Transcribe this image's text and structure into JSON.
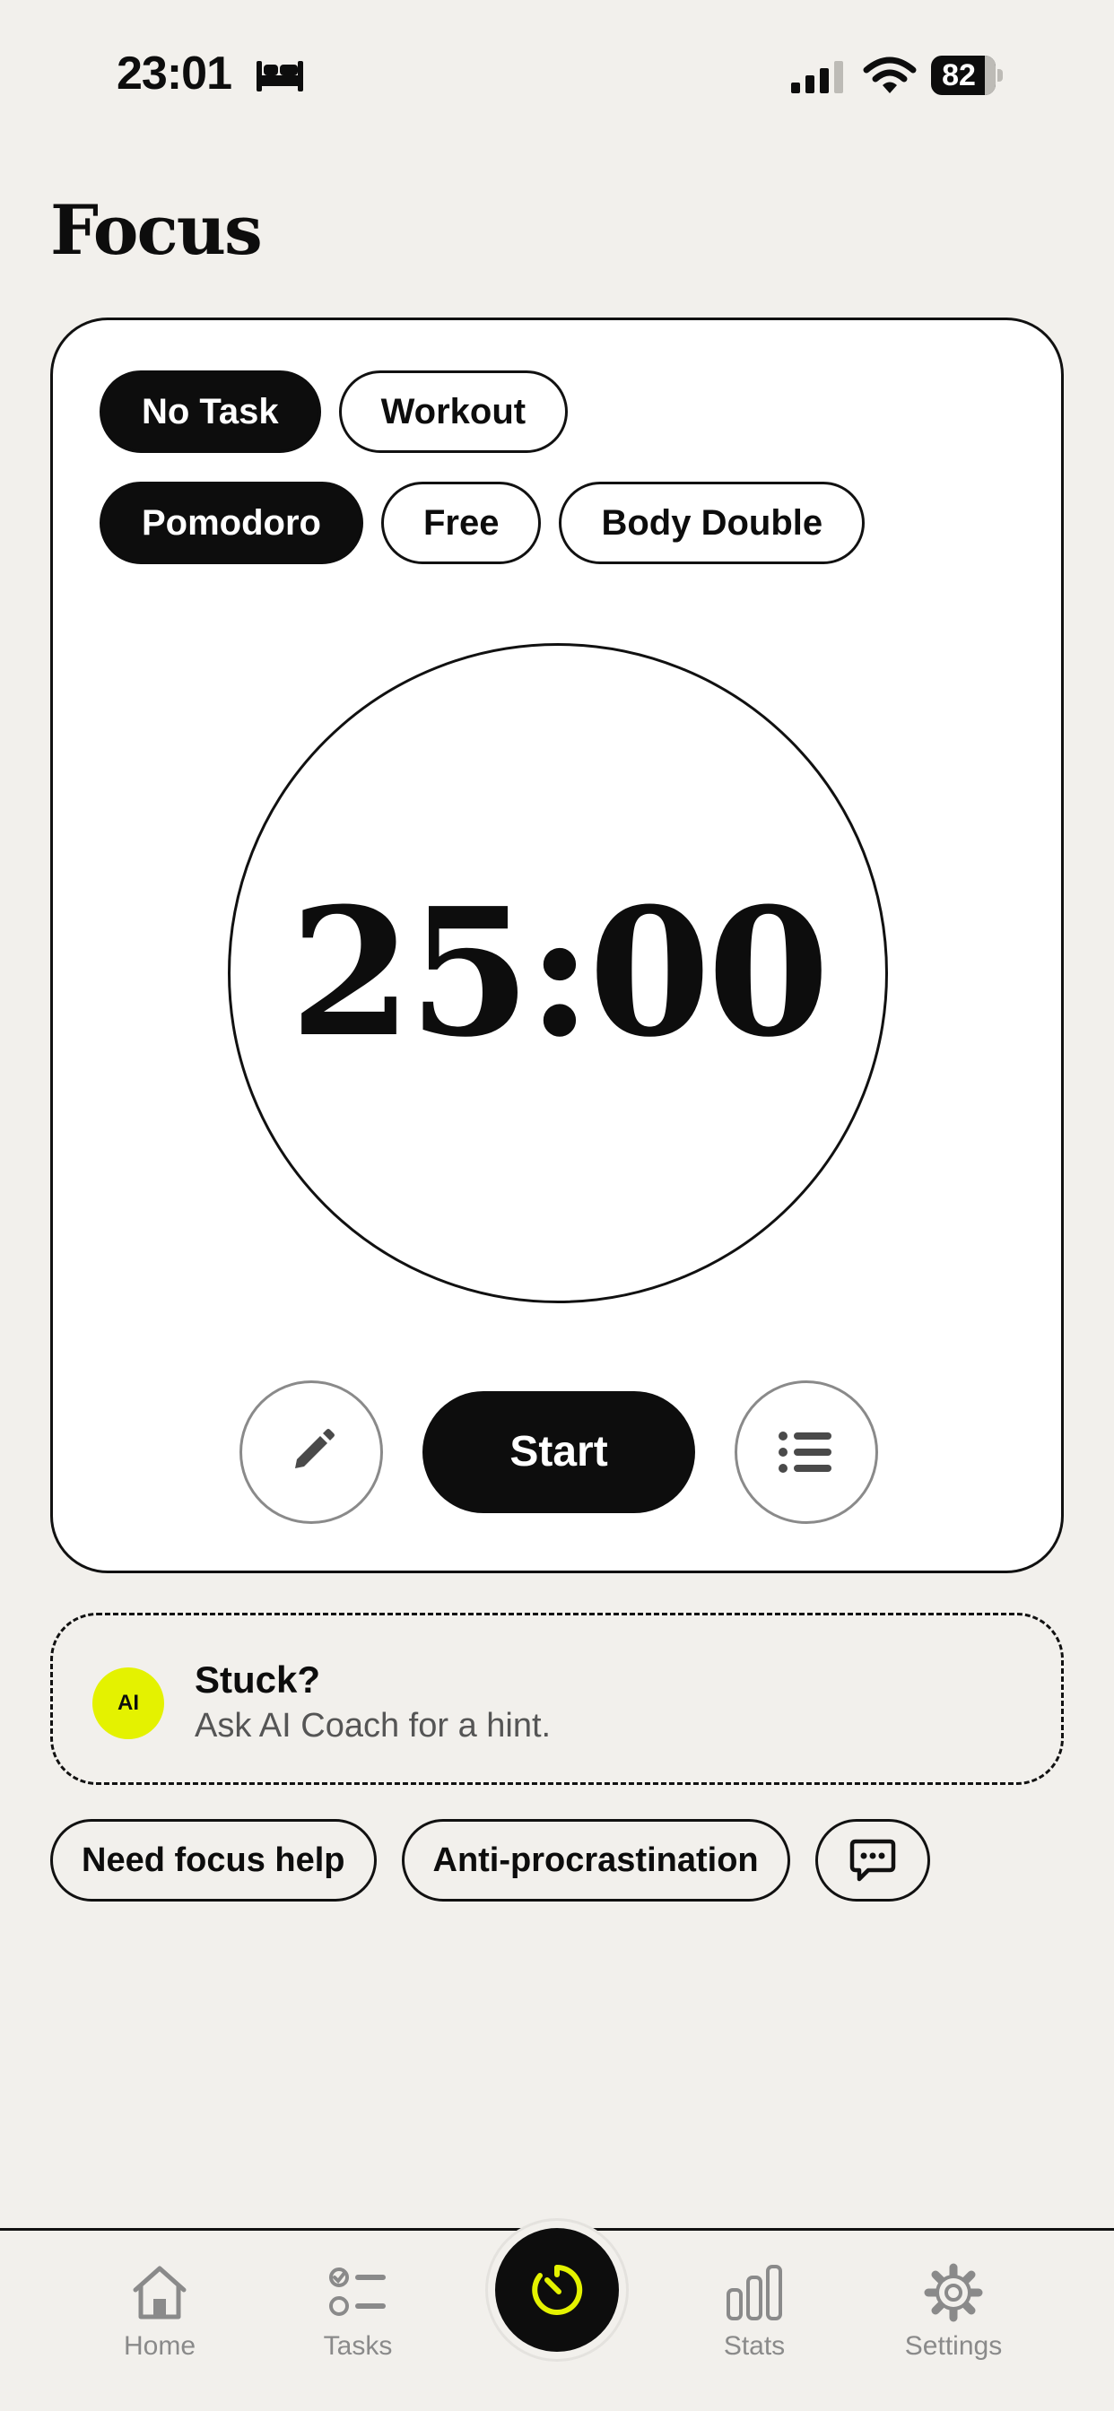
{
  "status_bar": {
    "time": "23:01",
    "battery": "82",
    "icons": [
      "bed-icon",
      "cellular-signal-icon",
      "wifi-icon",
      "battery-icon"
    ]
  },
  "page": {
    "title": "Focus"
  },
  "task_chips": [
    {
      "label": "No Task",
      "selected": true
    },
    {
      "label": "Workout",
      "selected": false
    }
  ],
  "mode_chips": [
    {
      "label": "Pomodoro",
      "selected": true
    },
    {
      "label": "Free",
      "selected": false
    },
    {
      "label": "Body Double",
      "selected": false
    }
  ],
  "timer": {
    "value": "25:00"
  },
  "controls": {
    "start_label": "Start",
    "edit_icon": "pencil-icon",
    "list_icon": "list-icon"
  },
  "coach": {
    "badge": "AI",
    "title": "Stuck?",
    "subtitle": "Ask AI Coach for a hint."
  },
  "quick_actions": [
    {
      "label": "Need focus help"
    },
    {
      "label": "Anti-procrastination"
    }
  ],
  "quick_chat_icon": "chat-bubble-icon",
  "tab_bar": {
    "tabs": [
      {
        "label": "Home",
        "icon": "home-icon"
      },
      {
        "label": "Tasks",
        "icon": "tasks-icon"
      },
      {
        "label": "Stats",
        "icon": "stats-icon"
      },
      {
        "label": "Settings",
        "icon": "settings-icon"
      }
    ],
    "center_icon": "timer-icon",
    "accent": "#e4f200"
  },
  "colors": {
    "background": "#f2f0ec",
    "card": "#ffffff",
    "ink": "#0d0d0d",
    "accent": "#e4f200",
    "muted": "#8a8a8a"
  }
}
